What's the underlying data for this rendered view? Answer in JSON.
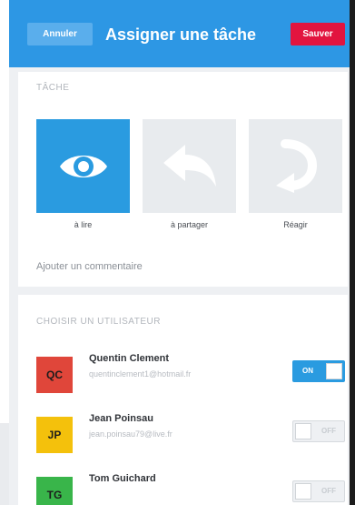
{
  "header": {
    "cancel_label": "Annuler",
    "title": "Assigner une tâche",
    "save_label": "Sauver"
  },
  "task": {
    "section_title": "TÂCHE",
    "options": [
      {
        "label": "à lire",
        "icon": "eye-icon",
        "selected": true
      },
      {
        "label": "à partager",
        "icon": "reply-arrow-icon",
        "selected": false
      },
      {
        "label": "Réagir",
        "icon": "curved-arrow-icon",
        "selected": false
      }
    ],
    "comment_placeholder": "Ajouter un commentaire"
  },
  "users": {
    "section_title": "CHOISIR UN UTILISATEUR",
    "items": [
      {
        "initials": "QC",
        "name": "Quentin Clement",
        "email": "quentinclement1@hotmail.fr",
        "toggle_label": "ON",
        "on": true,
        "avatar_color": "#e0463a"
      },
      {
        "initials": "JP",
        "name": "Jean Poinsau",
        "email": "jean.poinsau79@live.fr",
        "toggle_label": "OFF",
        "on": false,
        "avatar_color": "#f4c10c"
      },
      {
        "initials": "TG",
        "name": "Tom Guichard",
        "email": "",
        "toggle_label": "OFF",
        "on": false,
        "avatar_color": "#39b54a"
      }
    ]
  },
  "colors": {
    "primary": "#2d97e4",
    "danger": "#e2143f",
    "background": "#eef0f3"
  }
}
